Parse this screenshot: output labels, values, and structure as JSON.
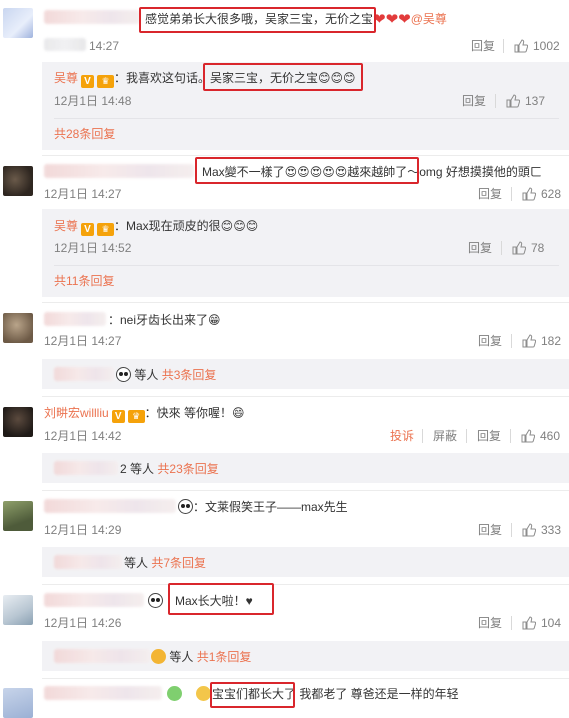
{
  "actions": {
    "reply": "回复",
    "report": "投诉",
    "block": "屏蔽",
    "others": "等人"
  },
  "c1": {
    "text": "感觉弟弟长大很多哦，吴家三宝，无价之宝",
    "mention": "@吴尊",
    "time": "14:27",
    "likes": "1002",
    "sub": {
      "name": "吴尊",
      "text": "：我喜欢这句话。吴家三宝，无价之宝😊😊😊",
      "time": "12月1日 14:48",
      "likes": "137"
    },
    "more": "共28条回复"
  },
  "c2": {
    "text": "Max變不一樣了😍😍😍😍😍越來越帥了～omg 好想摸摸他的頭ㄈ",
    "time": "12月1日 14:27",
    "likes": "628",
    "sub": {
      "name": "吴尊",
      "text": "：Max现在顽皮的很😊😊😊",
      "time": "12月1日 14:52",
      "likes": "78"
    },
    "more": "共11条回复"
  },
  "c3": {
    "text": "：nei牙齿长出来了😁",
    "time": "12月1日 14:27",
    "likes": "182",
    "more": "共3条回复"
  },
  "c4": {
    "name": "刘畊宏willliu",
    "text": "：快來 等你喔！😄",
    "time": "12月1日 14:42",
    "likes": "460",
    "prefix": "2",
    "more": "共23条回复"
  },
  "c5": {
    "text": "：文莱假笑王子——max先生",
    "time": "12月1日 14:29",
    "likes": "333",
    "more": "共7条回复"
  },
  "c6": {
    "text": "Max长大啦！♥",
    "time": "12月1日 14:26",
    "likes": "104",
    "more": "共1条回复"
  },
  "c7": {
    "text": "宝宝们都长大了 我都老了 尊爸还是一样的年轻"
  }
}
